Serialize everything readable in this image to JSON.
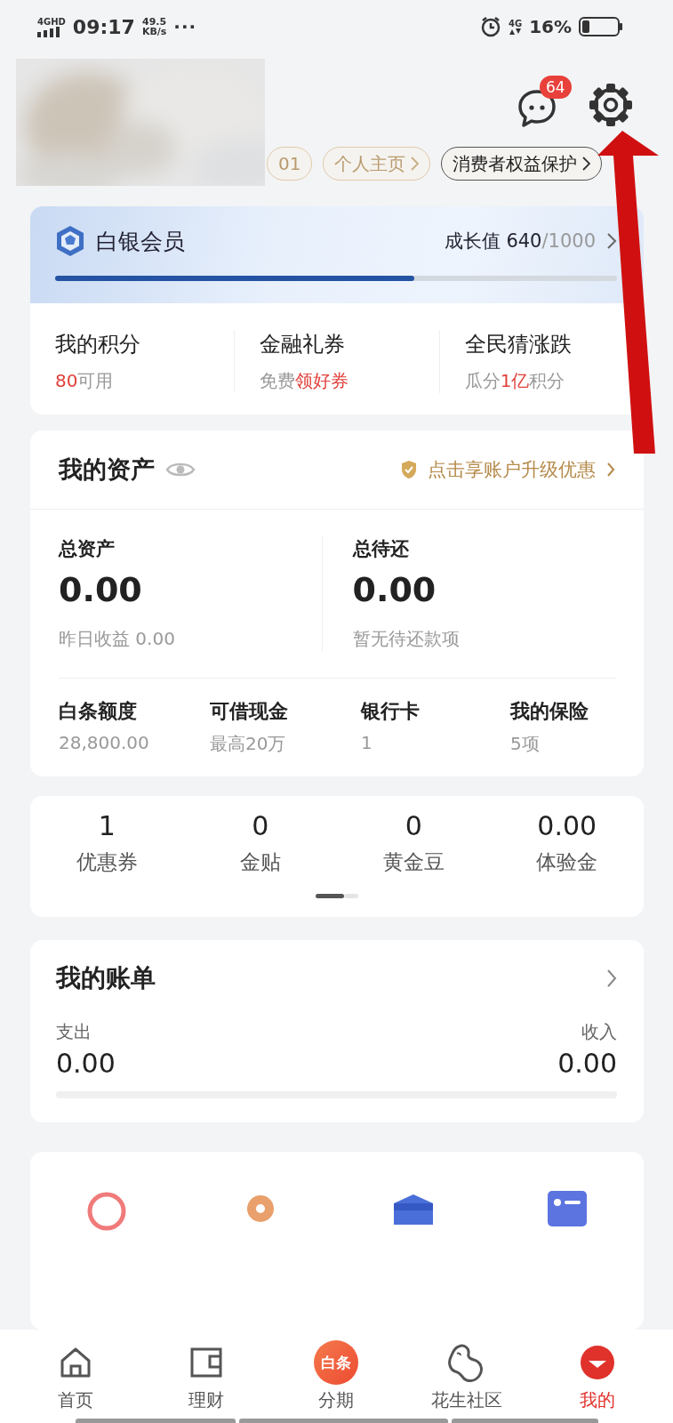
{
  "status_bar": {
    "network": "4GHD",
    "time": "09:17",
    "speed_value": "49.5",
    "speed_unit": "KB/s",
    "more": "···",
    "network_right": "4G",
    "battery": "16%"
  },
  "header": {
    "message_badge": "64",
    "tags": [
      {
        "label": "01",
        "kind": "gold"
      },
      {
        "label": "个人主页",
        "kind": "gold"
      },
      {
        "label": "消费者权益保护",
        "kind": "dark"
      }
    ]
  },
  "membership": {
    "title": "白银会员",
    "growth_label": "成长值",
    "growth_value": "640",
    "growth_total": "/1000",
    "level": 0.64,
    "items": [
      {
        "title": "我的积分",
        "subtitle": [
          {
            "text": "80",
            "highlight": true
          },
          {
            "text": "可用",
            "highlight": false
          }
        ]
      },
      {
        "title": "金融礼券",
        "subtitle": [
          {
            "text": "免费",
            "highlight": false
          },
          {
            "text": "领好券",
            "highlight": true
          }
        ]
      },
      {
        "title": "全民猜涨跌",
        "subtitle": [
          {
            "text": "瓜分",
            "highlight": false
          },
          {
            "text": "1亿",
            "highlight": true
          },
          {
            "text": "积分",
            "highlight": false
          }
        ]
      }
    ]
  },
  "assets": {
    "title": "我的资产",
    "promo": "点击享账户升级优惠",
    "totals": [
      {
        "label": "总资产",
        "value": "0.00",
        "note": "昨日收益 0.00"
      },
      {
        "label": "总待还",
        "value": "0.00",
        "note": "暂无待还款项"
      }
    ],
    "items": [
      {
        "label": "白条额度",
        "value": "28,800.00"
      },
      {
        "label": "可借现金",
        "value": "最高20万"
      },
      {
        "label": "银行卡",
        "value": "1"
      },
      {
        "label": "我的保险",
        "value": "5项"
      }
    ]
  },
  "stats": [
    {
      "value": "1",
      "label": "优惠券"
    },
    {
      "value": "0",
      "label": "金贴"
    },
    {
      "value": "0",
      "label": "黄金豆"
    },
    {
      "value": "0.00",
      "label": "体验金"
    }
  ],
  "bill": {
    "title": "我的账单",
    "expense_label": "支出",
    "expense": "0.00",
    "income_label": "收入",
    "income": "0.00"
  },
  "nav": [
    {
      "label": "首页",
      "kind": "home",
      "selected": false
    },
    {
      "label": "理财",
      "kind": "wallet",
      "selected": false
    },
    {
      "label": "分期",
      "kind": "baitiao",
      "icon_text": "白条",
      "selected": false
    },
    {
      "label": "花生社区",
      "kind": "peanut",
      "selected": false
    },
    {
      "label": "我的",
      "kind": "mine",
      "selected": true
    }
  ]
}
